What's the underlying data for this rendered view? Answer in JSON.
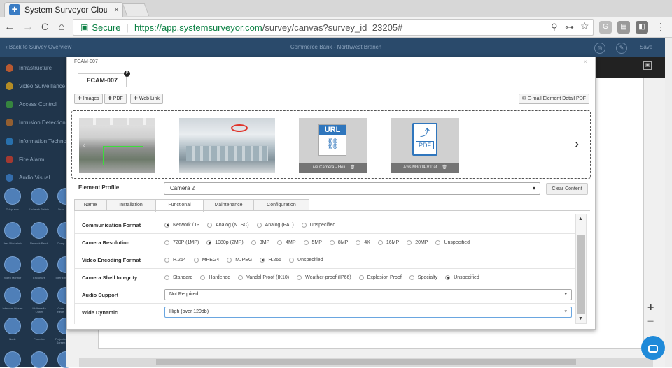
{
  "browser": {
    "tab_title": "System Surveyor Cloud V",
    "tab_close": "×",
    "url_secure": "Secure",
    "url_scheme": "https://",
    "url_host": "app.systemsurveyor.com",
    "url_path": "/survey/canvas?survey_id=23205#"
  },
  "app": {
    "back": "‹ Back to Survey Overview",
    "title": "Commerce Bank - Northwest Branch",
    "save": "Save"
  },
  "sidebar": {
    "items": [
      {
        "label": "Infrastructure",
        "color": "#e0632a"
      },
      {
        "label": "Video Surveillance",
        "color": "#d9a21b"
      },
      {
        "label": "Access Control",
        "color": "#3c9a3c"
      },
      {
        "label": "Intrusion Detection",
        "color": "#b06a2a"
      },
      {
        "label": "Information Techno",
        "color": "#2a7fc4"
      },
      {
        "label": "Fire Alarm",
        "color": "#c43b2a"
      },
      {
        "label": "Audio Visual",
        "color": "#3a7cc4"
      }
    ],
    "tiles": [
      [
        "Telephone",
        "Network Switch",
        "Serv"
      ],
      [
        "User Workstatio",
        "Network Patch",
        "Comp"
      ],
      [
        "Video Monitor",
        "Enclosure",
        "Inter Ext"
      ],
      [
        "Intercom Master",
        "Multimedia Outlet",
        "Cove Recei"
      ],
      [
        "Node",
        "Projector",
        "Projection Screen"
      ]
    ]
  },
  "modal": {
    "title": "FCAM-007",
    "close": "×",
    "tab": "FCAM-007",
    "tab_badge": "P",
    "buttons": {
      "images": "✚ Images",
      "pdf": "✚ PDF",
      "weblink": "✚ Web Link",
      "email": "✉ E-mail Element Detail PDF"
    },
    "attachments": [
      {
        "caption": "Live Camera - Heli...",
        "type": "URL"
      },
      {
        "caption": "Axis M3004-V Dat...",
        "type": "PDF"
      }
    ],
    "element_profile_label": "Element Profile",
    "element_profile_value": "Camera 2",
    "clear_content": "Clear Content",
    "subtabs": [
      "Name",
      "Installation",
      "Functional",
      "Maintenance",
      "Configuration"
    ],
    "active_subtab": "Functional",
    "fields": [
      {
        "label": "Communication Format",
        "options": [
          "Network / IP",
          "Analog (NTSC)",
          "Analog (PAL)",
          "Unspecified"
        ],
        "selected": "Network / IP"
      },
      {
        "label": "Camera Resolution",
        "options": [
          "720P (1MP)",
          "1080p (2MP)",
          "3MP",
          "4MP",
          "5MP",
          "8MP",
          "4K",
          "16MP",
          "20MP",
          "Unspecified"
        ],
        "selected": "1080p (2MP)"
      },
      {
        "label": "Video Encoding Format",
        "options": [
          "H.264",
          "MPEG4",
          "MJPEG",
          "H.265",
          "Unspecified"
        ],
        "selected": "H.265"
      },
      {
        "label": "Camera Shell Integrity",
        "options": [
          "Standard",
          "Hardened",
          "Vandal Proof (IK10)",
          "Weather-proof (IP66)",
          "Explosion Proof",
          "Specialty",
          "Unspecified"
        ],
        "selected": "Unspecified"
      },
      {
        "label": "Audio Support",
        "select": "Not Required"
      },
      {
        "label": "Wide Dynamic",
        "select": "High (over 120db)"
      }
    ]
  },
  "icons": {
    "back": "←",
    "forward": "→",
    "reload": "C",
    "home": "⌂",
    "lock": "🔒",
    "key": "⊶",
    "star": "☆",
    "menu": "⋮",
    "chevron_right": "›",
    "chevron_left": "‹",
    "plus": "+",
    "minus": "−",
    "chat": "▭",
    "caret": "▾"
  }
}
